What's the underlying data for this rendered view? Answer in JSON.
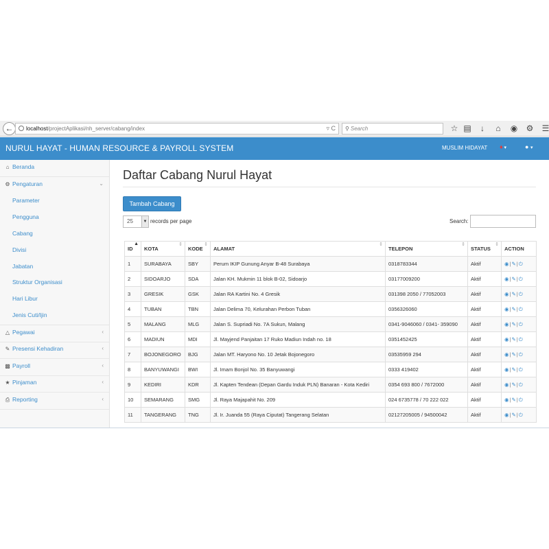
{
  "browser": {
    "url_host": "localhost",
    "url_path": "/projectAplikasi/nh_server/cabang/index",
    "search_placeholder": "Search"
  },
  "header": {
    "app_title": "NURUL HAYAT - HUMAN RESOURCE & PAYROLL SYSTEM",
    "user_name": "MUSLIM HIDAYAT"
  },
  "sidebar": {
    "items": [
      {
        "label": "Beranda",
        "icon": "home-icon"
      },
      {
        "label": "Pengaturan",
        "icon": "cogs-icon"
      },
      {
        "label": "Parameter"
      },
      {
        "label": "Pengguna"
      },
      {
        "label": "Cabang"
      },
      {
        "label": "Divisi"
      },
      {
        "label": "Jabatan"
      },
      {
        "label": "Struktur Organisasi"
      },
      {
        "label": "Hari Libur"
      },
      {
        "label": "Jenis Cuti/Ijin"
      },
      {
        "label": "Pegawai",
        "icon": "sitemap-icon"
      },
      {
        "label": "Presensi Kehadiran",
        "icon": "edit-icon"
      },
      {
        "label": "Payroll",
        "icon": "money-icon"
      },
      {
        "label": "Pinjaman",
        "icon": "star-icon"
      },
      {
        "label": "Reporting",
        "icon": "print-icon"
      }
    ]
  },
  "main": {
    "title": "Daftar Cabang Nurul Hayat",
    "add_button": "Tambah Cabang",
    "page_length": "25",
    "page_length_label": "records per page",
    "search_label": "Search:",
    "columns": [
      "ID",
      "KOTA",
      "KODE",
      "ALAMAT",
      "TELEPON",
      "STATUS",
      "ACTION"
    ],
    "rows": [
      {
        "id": "1",
        "kota": "SURABAYA",
        "kode": "SBY",
        "alamat": "Perum IKIP Gunung Anyar B-48 Surabaya",
        "telepon": "0318783344",
        "status": "Aktif"
      },
      {
        "id": "2",
        "kota": "SIDOARJO",
        "kode": "SDA",
        "alamat": "Jalan KH. Mukmin 11 blok B-02, Sidoarjo",
        "telepon": "03177009200",
        "status": "Aktif"
      },
      {
        "id": "3",
        "kota": "GRESIK",
        "kode": "GSK",
        "alamat": "Jalan RA Kartini No. 4 Gresik",
        "telepon": "031398 2050 / 77052003",
        "status": "Aktif"
      },
      {
        "id": "4",
        "kota": "TUBAN",
        "kode": "TBN",
        "alamat": "Jalan Delima 70, Kelurahan Perbon Tuban",
        "telepon": "0356326060",
        "status": "Aktif"
      },
      {
        "id": "5",
        "kota": "MALANG",
        "kode": "MLG",
        "alamat": "Jalan S. Supriadi No. 7A Sukun, Malang",
        "telepon": "0341-9046060 / 0341- 359090",
        "status": "Aktif"
      },
      {
        "id": "6",
        "kota": "MADIUN",
        "kode": "MDI",
        "alamat": "Jl. Mayjend Panjaitan 17 Ruko Madiun Indah no. 18",
        "telepon": "0351452425",
        "status": "Aktif"
      },
      {
        "id": "7",
        "kota": "BOJONEGORO",
        "kode": "BJG",
        "alamat": "Jalan MT. Haryono No. 10 Jetak Bojonegoro",
        "telepon": "03535959 294",
        "status": "Aktif"
      },
      {
        "id": "8",
        "kota": "BANYUWANGI",
        "kode": "BWI",
        "alamat": "Jl. Imam Bonjol No. 35 Banyuwangi",
        "telepon": "0333 419402",
        "status": "Aktif"
      },
      {
        "id": "9",
        "kota": "KEDIRI",
        "kode": "KDR",
        "alamat": "Jl. Kapten Tendean (Depan Gardu Induk PLN) Banaran - Kota Kediri",
        "telepon": "0354 693 800 / 7672000",
        "status": "Aktif"
      },
      {
        "id": "10",
        "kota": "SEMARANG",
        "kode": "SMG",
        "alamat": "Jl. Raya Majapahit No. 209",
        "telepon": "024 6735778 / 70 222 022",
        "status": "Aktif"
      },
      {
        "id": "11",
        "kota": "TANGERANG",
        "kode": "TNG",
        "alamat": "Jl. Ir. Juanda 55 (Raya Ciputat) Tangerang Selatan",
        "telepon": "02127205005 / 94500042",
        "status": "Aktif"
      }
    ]
  },
  "colors": {
    "primary": "#3c8dcb",
    "sidebar_bg": "#f7f7f7",
    "badge_red": "#e23b3b"
  }
}
